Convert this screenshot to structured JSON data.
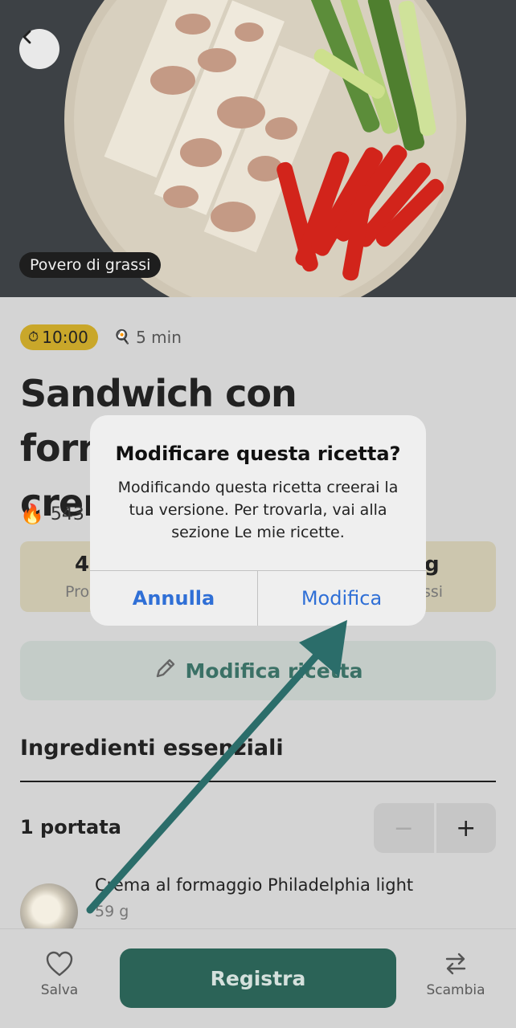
{
  "hero": {
    "badge": "Povero di grassi",
    "back_icon": "chevron-left-icon"
  },
  "recipe": {
    "timer": "10:00",
    "time": "5 min",
    "title_line1": "Sandwich con formaggio",
    "title_line2": "crem",
    "kcal": "543",
    "macro_left_value": "4",
    "macro_left_label": "Pro",
    "macro_right_value": "g",
    "macro_right_label": "ssi",
    "edit_button": "Modifica ricetta",
    "section_title": "Ingredienti essenziali",
    "portions": "1 portata",
    "stepper_minus": "−",
    "stepper_plus": "+",
    "ingredient_name": "Crema al formaggio Philadelphia light",
    "ingredient_qty": "59 g"
  },
  "dialog": {
    "title": "Modificare questa ricetta?",
    "message": "Modificando questa ricetta creerai la tua versione. Per trovarla, vai alla sezione Le mie ricette.",
    "cancel": "Annulla",
    "confirm": "Modifica"
  },
  "bottom_bar": {
    "save": "Salva",
    "register": "Registra",
    "swap": "Scambia"
  },
  "colors": {
    "accent": "#2b6357",
    "link_blue": "#2f6fd6",
    "timer_badge": "#c9a72a",
    "arrow": "#2b6d6a"
  }
}
